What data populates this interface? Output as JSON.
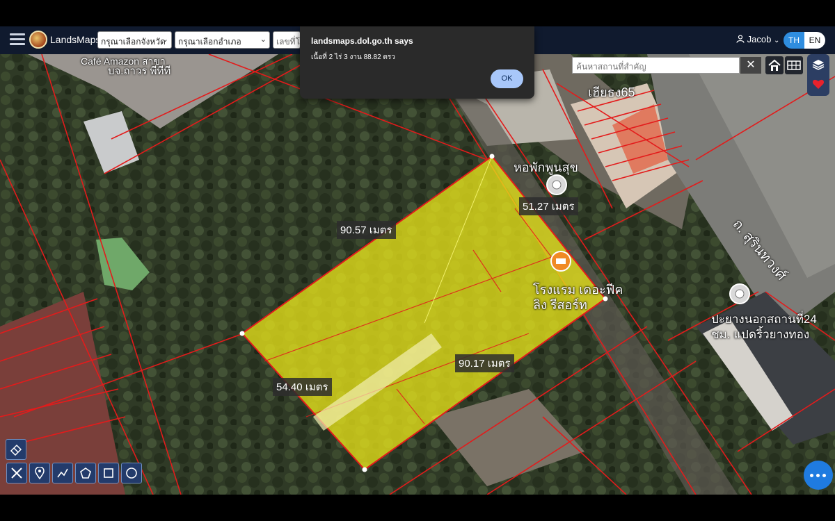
{
  "header": {
    "brand": "LandsMaps",
    "province_select": "กรุณาเลือกจังหวัด",
    "district_select": "กรุณาเลือกอำเภอ",
    "parcel_input": "เลขที่โ",
    "user_name": "Jacob",
    "lang_th": "TH",
    "lang_en": "EN"
  },
  "search": {
    "placeholder": "ค้นหาสถานที่สำคัญ"
  },
  "dialog": {
    "title": "landsmaps.dol.go.th says",
    "message": "เนื้อที่ 2 ไร่ 3 งาน 88.82 ตรว",
    "ok_label": "OK"
  },
  "map": {
    "labels": {
      "cafe": "Café Amazon",
      "cafe_thai": "สาขา",
      "cafe_line2": "บจ.ถาวร พีทีที",
      "hiang": "เฮียธง65",
      "dorm": "หอพักพูนสุข",
      "road": "ถ. สุรินทวงศ์",
      "hotel_line1": "โรงแรม เดอะฟีค",
      "hotel_line2": "ลิง รีสอร์ท",
      "station_line1": "ปะยางนอกสถานที่24",
      "station_line2": "ชม. แปดริ้วยางทอง"
    },
    "distances": {
      "top": "90.57 เมตร",
      "right": "51.27 เมตร",
      "bottom": "90.17 เมตร",
      "left": "54.40 เมตร"
    }
  },
  "colors": {
    "parcel_fill": "#e6e21a",
    "boundary": "#e31b1b",
    "header_bg": "#101a2e",
    "accent": "#2f8ddf"
  }
}
